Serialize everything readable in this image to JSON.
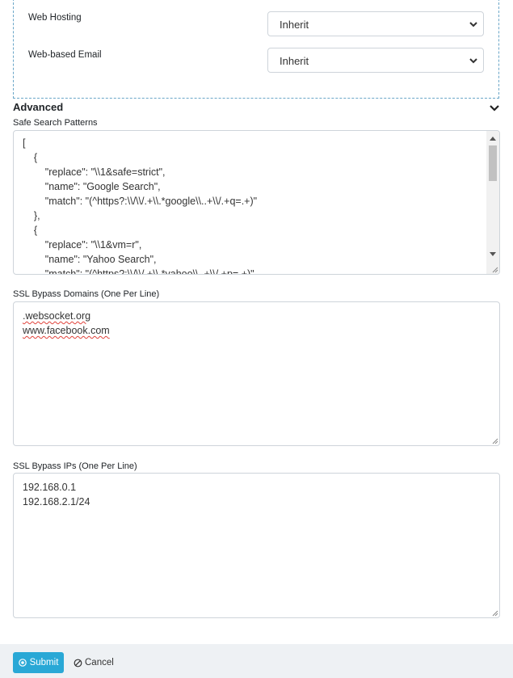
{
  "general": {
    "rows": [
      {
        "label": "Web Hosting",
        "value": "Inherit"
      },
      {
        "label": "Web-based Email",
        "value": "Inherit"
      }
    ]
  },
  "advanced": {
    "title": "Advanced",
    "safe_search": {
      "label": "Safe Search Patterns",
      "lines": [
        "[",
        "    {",
        "        \"replace\": \"\\\\1&safe=strict\",",
        "        \"name\": \"Google Search\",",
        "        \"match\": \"(^https?:\\\\/\\\\/.+\\\\.*google\\\\..+\\\\/.+q=.+)\"",
        "    },",
        "    {",
        "        \"replace\": \"\\\\1&vm=r\",",
        "        \"name\": \"Yahoo Search\",",
        "        \"match\": \"(^https?:\\\\/\\\\/.+\\\\.*yahoo\\\\..+\\\\/.+p=.+)\""
      ]
    },
    "ssl_domains": {
      "label": "SSL Bypass Domains (One Per Line)",
      "lines": [
        ".websocket.org",
        "www.facebook.com"
      ]
    },
    "ssl_ips": {
      "label": "SSL Bypass IPs (One Per Line)",
      "lines": [
        "192.168.0.1",
        "192.168.2.1/24"
      ]
    }
  },
  "footer": {
    "submit_label": "Submit",
    "cancel_label": "Cancel"
  },
  "colors": {
    "accent": "#29a8d6",
    "dashed_border": "#6aa6c8",
    "footer_bg": "#eef1f4"
  }
}
